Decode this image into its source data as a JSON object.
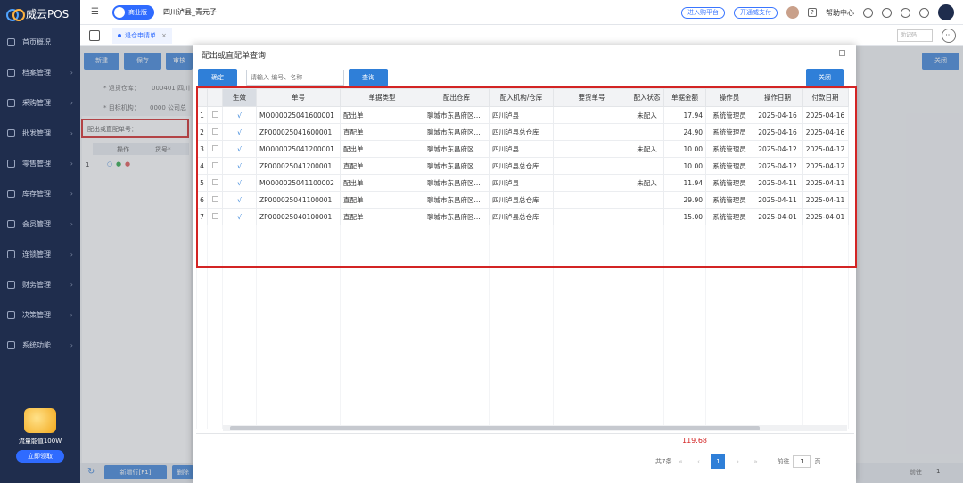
{
  "app": {
    "name": "威云POS"
  },
  "sidebar": {
    "items": [
      {
        "label": "首页概况",
        "icon": "home-icon"
      },
      {
        "label": "档案管理",
        "icon": "archive-icon"
      },
      {
        "label": "采购管理",
        "icon": "cart-icon"
      },
      {
        "label": "批发管理",
        "icon": "wholesale-icon"
      },
      {
        "label": "零售管理",
        "icon": "retail-icon"
      },
      {
        "label": "库存管理",
        "icon": "inventory-icon"
      },
      {
        "label": "会员管理",
        "icon": "member-icon"
      },
      {
        "label": "连锁管理",
        "icon": "chain-icon"
      },
      {
        "label": "财务管理",
        "icon": "finance-icon"
      },
      {
        "label": "决策管理",
        "icon": "decision-icon"
      },
      {
        "label": "系统功能",
        "icon": "settings-icon"
      }
    ],
    "promo": {
      "text": "流量能值100W",
      "button": "立即领取"
    }
  },
  "header": {
    "edition": "商业版",
    "store": "四川泸县_青元子",
    "btn_platform": "进入购平台",
    "btn_pay": "开通威支付",
    "help": "帮助中心"
  },
  "tabbar": {
    "tab": "退仓申请单",
    "search_placeholder": "助记码"
  },
  "background": {
    "buttons": [
      "新建",
      "保存",
      "审核"
    ],
    "field_warehouse_label": "* 退货仓库：",
    "field_warehouse_value": "000401 四川",
    "field_target_label": "* 目标机构：",
    "field_target_value": "0000 公司总",
    "ref_label": "配出或直配单号：",
    "col_op": "操作",
    "col_code": "货号*",
    "row1": "1",
    "close": "关闭",
    "bottom_btns": [
      "新增行[F1]",
      "删除"
    ],
    "pager_label": "前往",
    "pager_val": "1"
  },
  "dialog": {
    "title": "配出或直配单查询",
    "ok": "确定",
    "search_placeholder": "请输入 编号、名称",
    "query": "查询",
    "close": "关闭",
    "columns": [
      "",
      "",
      "生效",
      "单号",
      "单据类型",
      "配出仓库",
      "配入机构/仓库",
      "要货单号",
      "配入状态",
      "单据金额",
      "操作员",
      "操作日期",
      "付款日期"
    ],
    "rows": [
      {
        "n": "1",
        "ok": "√",
        "no": "MO000025041600001",
        "type": "配出单",
        "out": "聊城市东昌府区...",
        "in": "四川泸县",
        "req": "",
        "status": "未配入",
        "amount": "17.94",
        "op": "系统管理员",
        "date": "2025-04-16",
        "pay": "2025-04-16"
      },
      {
        "n": "2",
        "ok": "√",
        "no": "ZP000025041600001",
        "type": "直配单",
        "out": "聊城市东昌府区...",
        "in": "四川泸县总仓库",
        "req": "",
        "status": "",
        "amount": "24.90",
        "op": "系统管理员",
        "date": "2025-04-16",
        "pay": "2025-04-16"
      },
      {
        "n": "3",
        "ok": "√",
        "no": "MO000025041200001",
        "type": "配出单",
        "out": "聊城市东昌府区...",
        "in": "四川泸县",
        "req": "",
        "status": "未配入",
        "amount": "10.00",
        "op": "系统管理员",
        "date": "2025-04-12",
        "pay": "2025-04-12"
      },
      {
        "n": "4",
        "ok": "√",
        "no": "ZP000025041200001",
        "type": "直配单",
        "out": "聊城市东昌府区...",
        "in": "四川泸县总仓库",
        "req": "",
        "status": "",
        "amount": "10.00",
        "op": "系统管理员",
        "date": "2025-04-12",
        "pay": "2025-04-12"
      },
      {
        "n": "5",
        "ok": "√",
        "no": "MO000025041100002",
        "type": "配出单",
        "out": "聊城市东昌府区...",
        "in": "四川泸县",
        "req": "",
        "status": "未配入",
        "amount": "11.94",
        "op": "系统管理员",
        "date": "2025-04-11",
        "pay": "2025-04-11"
      },
      {
        "n": "6",
        "ok": "√",
        "no": "ZP000025041100001",
        "type": "直配单",
        "out": "聊城市东昌府区...",
        "in": "四川泸县总仓库",
        "req": "",
        "status": "",
        "amount": "29.90",
        "op": "系统管理员",
        "date": "2025-04-11",
        "pay": "2025-04-11"
      },
      {
        "n": "7",
        "ok": "√",
        "no": "ZP000025040100001",
        "type": "直配单",
        "out": "聊城市东昌府区...",
        "in": "四川泸县总仓库",
        "req": "",
        "status": "",
        "amount": "15.00",
        "op": "系统管理员",
        "date": "2025-04-01",
        "pay": "2025-04-01"
      }
    ],
    "total": "119.68",
    "pager": {
      "count": "共7条",
      "current": "1",
      "goto_label": "前往",
      "goto_value": "1",
      "page_suffix": "页"
    }
  }
}
